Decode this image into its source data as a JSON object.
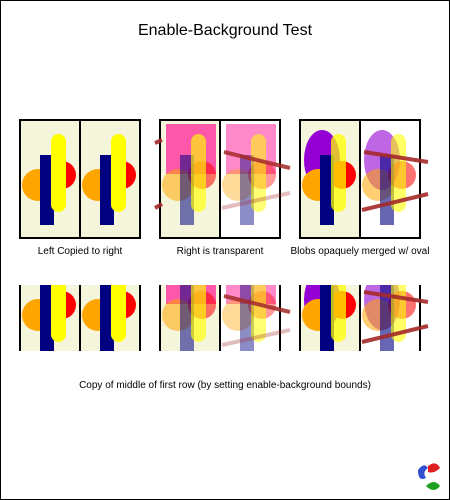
{
  "title": "Enable-Background Test",
  "captions": {
    "left": "Left Copied to right",
    "middle": "Right is transparent",
    "right": "Blobs opaquely merged w/ oval",
    "row2": "Copy of middle of first row (by setting enable-background bounds)"
  },
  "colors": {
    "panel_bg": "#f5f5dc",
    "navy": "#000080",
    "yellow": "#ffff00",
    "orange": "#ffa500",
    "red": "#ff0000",
    "pink": "#ff1493",
    "purple": "#9400d3",
    "brown": "#a52a2a"
  },
  "logo": {
    "name": "svg-logo-icon"
  }
}
